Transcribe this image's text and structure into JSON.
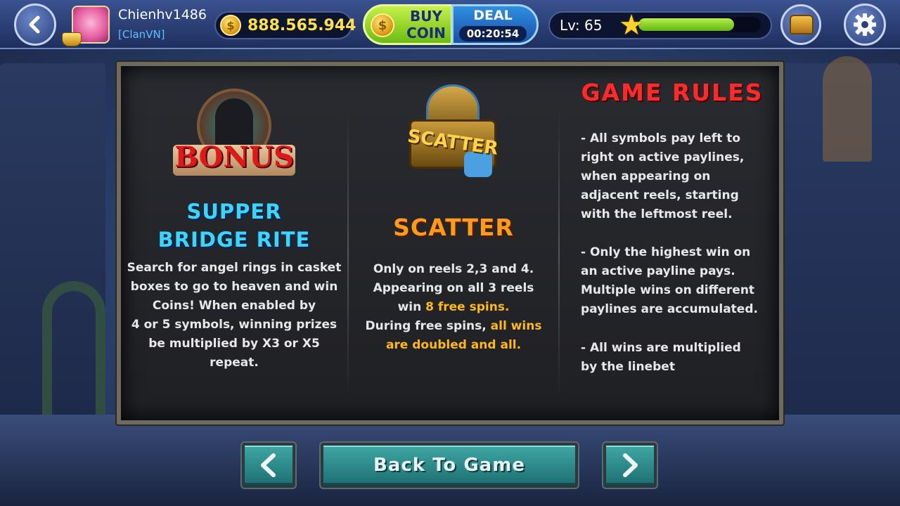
{
  "header": {
    "username": "Chienhv1486",
    "clan": "[ClanVN]",
    "coins": "888.565.944",
    "buy_coin_line1": "BUY",
    "buy_coin_line2": "COIN",
    "deal_title": "DEAL",
    "deal_timer": "00:20:54",
    "level": "Lv: 65",
    "xp_progress_percent": 78
  },
  "bonus": {
    "symbol_text": "BONUS",
    "title_line1": "SUPPER",
    "title_line2": "BRIDGE RITE",
    "description": [
      "Search for angel rings in casket",
      "boxes to go to heaven and win",
      "Coins! When enabled by",
      "4 or 5 symbols, winning prizes",
      "be multiplied by X3 or X5",
      "repeat."
    ]
  },
  "scatter": {
    "symbol_text": "SCATTER",
    "title": "SCATTER",
    "line1": "Only on reels 2,3 and 4.",
    "line2": "Appearing on all 3 reels",
    "line3_prefix": "win ",
    "line3_highlight": "8 free spins.",
    "line4_prefix": "During free spins, ",
    "line4_highlight": "all wins",
    "line5_highlight": "are doubled and all."
  },
  "rules": {
    "title": "GAME RULES",
    "rule1": [
      "- All symbols pay left to",
      "right on active paylines,",
      "when appearing on",
      "adjacent reels, starting",
      "with the leftmost reel."
    ],
    "rule2": [
      "- Only the highest win on",
      "an active payline pays.",
      "Multiple wins on different",
      "paylines are accumulated."
    ],
    "rule3": [
      "- All wins are multiplied",
      "by the linebet"
    ]
  },
  "footer": {
    "prev_icon": "‹",
    "back_to_game": "Back To Game",
    "next_icon": "›"
  },
  "colors": {
    "cyan_title": "#3ad6ff",
    "orange_title": "#ff9a1a",
    "red_title": "#ff2a2a",
    "highlight": "#ffb81a",
    "coin_text": "#ffe14a"
  },
  "icons": [
    "back-arrow-icon",
    "gear-icon",
    "coin-icon",
    "star-icon",
    "treasure-chest-icon",
    "chevron-left-icon",
    "chevron-right-icon"
  ]
}
